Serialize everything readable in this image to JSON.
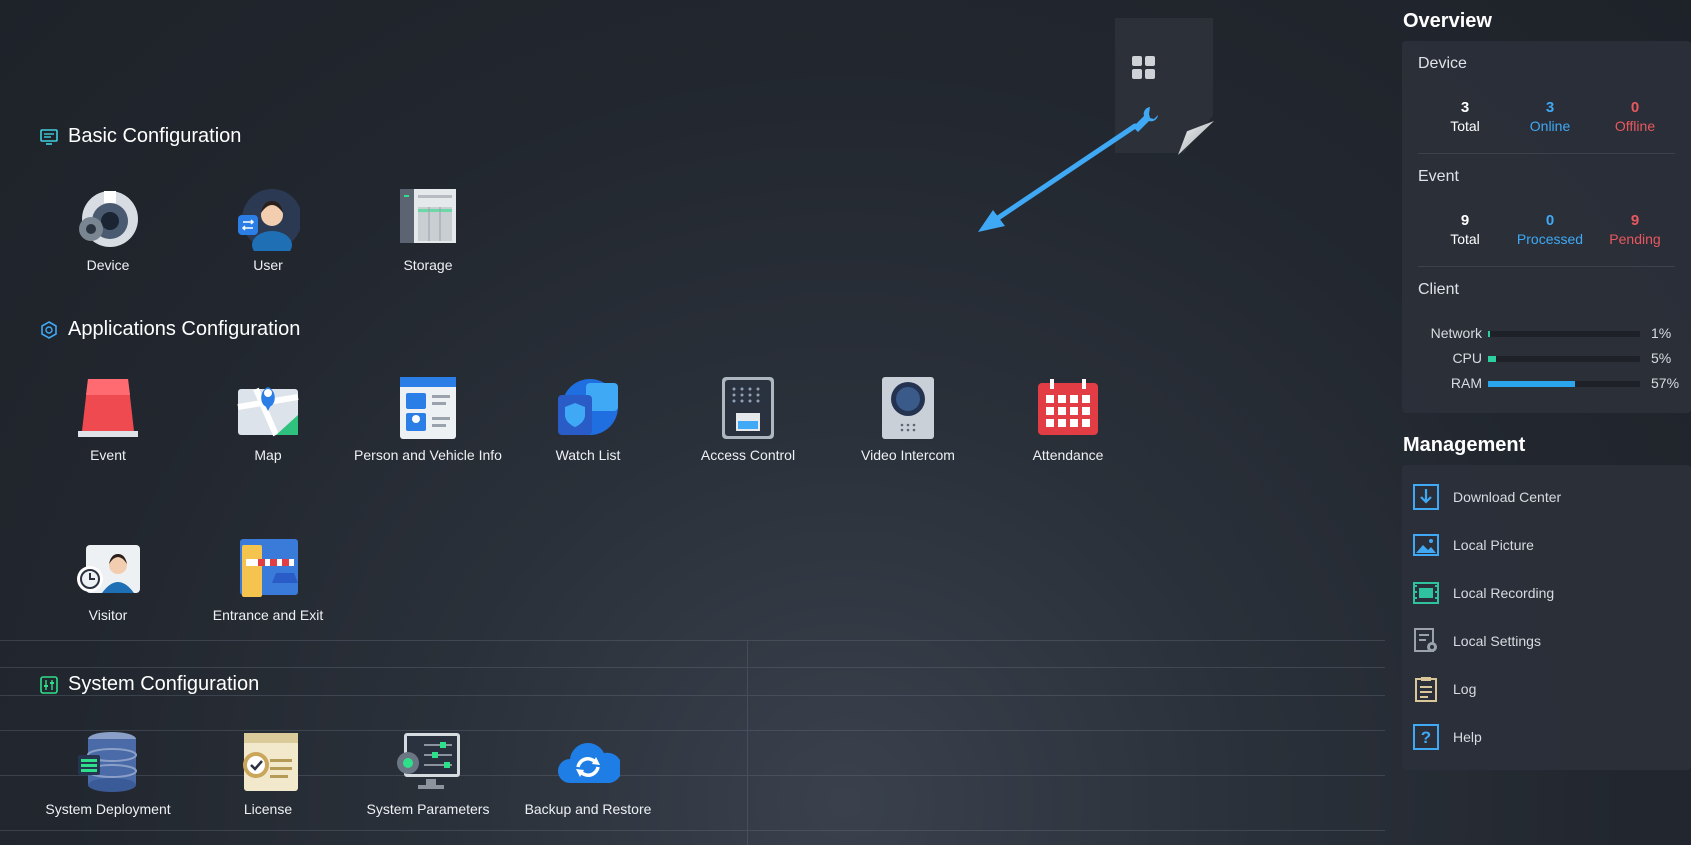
{
  "sections": {
    "basic": "Basic Configuration",
    "applications": "Applications Configuration",
    "system": "System Configuration"
  },
  "basic_apps": [
    "Device",
    "User",
    "Storage"
  ],
  "app_apps": [
    "Event",
    "Map",
    "Person and Vehicle Info",
    "Watch List",
    "Access Control",
    "Video Intercom",
    "Attendance",
    "Visitor",
    "Entrance and Exit"
  ],
  "system_apps": [
    "System Deployment",
    "License",
    "System Parameters",
    "Backup and Restore"
  ],
  "overview": {
    "title": "Overview",
    "device": {
      "title": "Device",
      "total": "3",
      "total_label": "Total",
      "online": "3",
      "online_label": "Online",
      "offline": "0",
      "offline_label": "Offline"
    },
    "event": {
      "title": "Event",
      "total": "9",
      "total_label": "Total",
      "processed": "0",
      "processed_label": "Processed",
      "pending": "9",
      "pending_label": "Pending"
    },
    "client": {
      "title": "Client",
      "network": {
        "label": "Network",
        "percent": "1%",
        "value": 1
      },
      "cpu": {
        "label": "CPU",
        "percent": "5%",
        "value": 5
      },
      "ram": {
        "label": "RAM",
        "percent": "57%",
        "value": 57
      }
    }
  },
  "management": {
    "title": "Management",
    "items": [
      "Download Center",
      "Local Picture",
      "Local Recording",
      "Local Settings",
      "Log",
      "Help"
    ]
  },
  "colors": {
    "accent": "#3fa9f5",
    "online": "#3fa9f5",
    "offline": "#e8585e",
    "bar_ok": "#2fd0a0",
    "bar_ram": "#2aa5ee"
  },
  "icons": [
    "grid-icon",
    "wrench-icon",
    "arrow-icon"
  ]
}
